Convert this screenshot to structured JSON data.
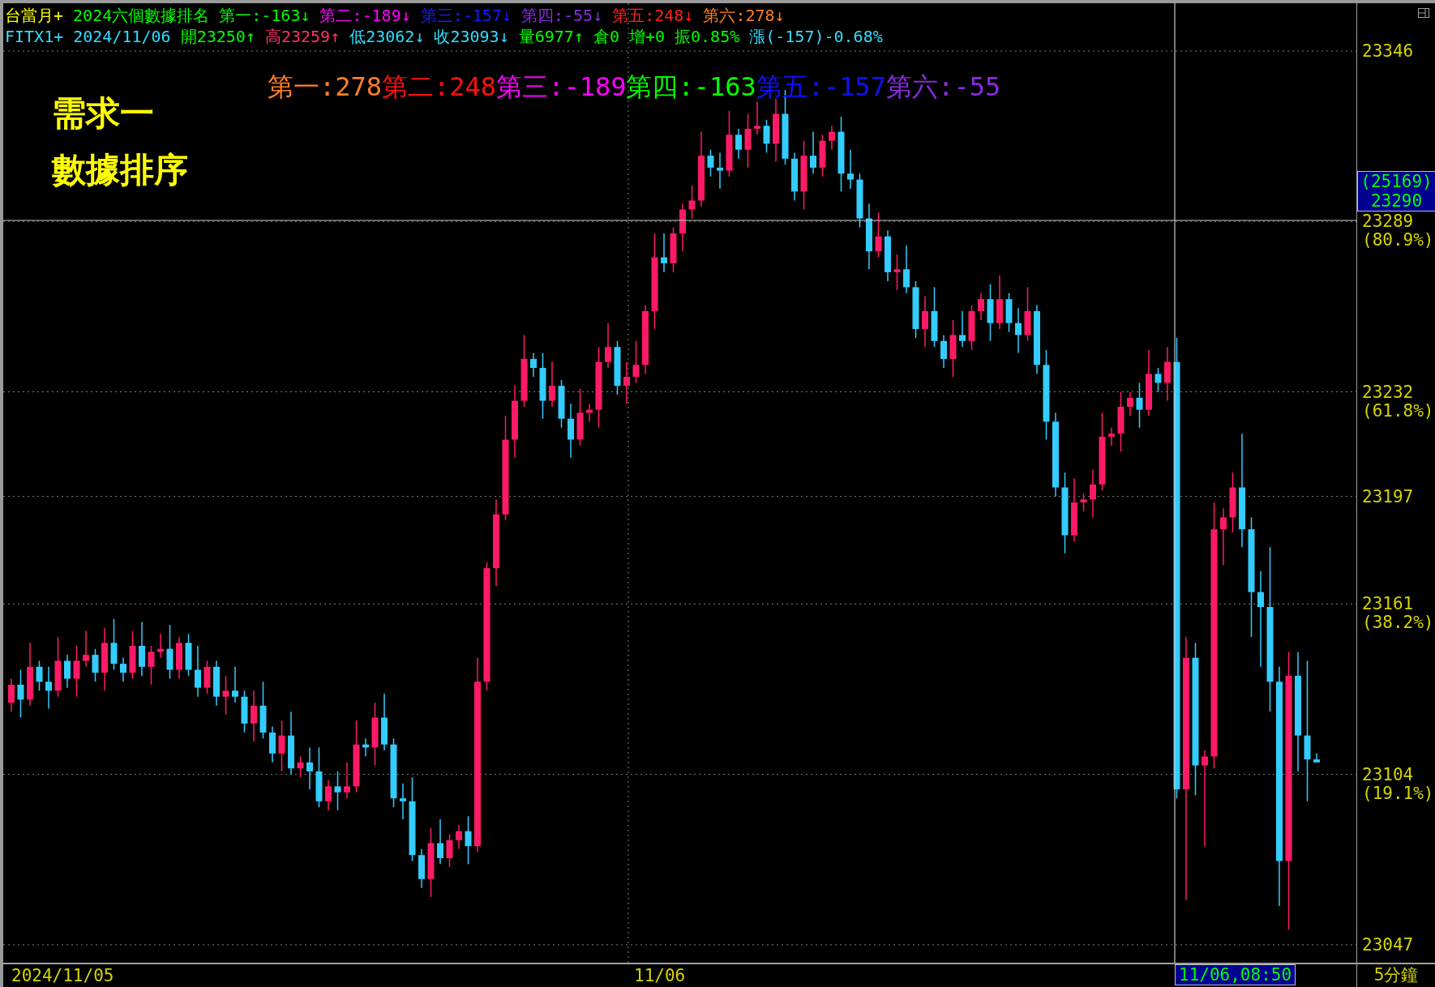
{
  "title_bar": {
    "symbol": "台當月+",
    "title": "2024六個數據排名",
    "rankings": [
      {
        "text": "第一:-163↓",
        "color": "#00ff00"
      },
      {
        "text": "第二:-189↓",
        "color": "#ff00ff"
      },
      {
        "text": "第三:-157↓",
        "color": "#1a1aff"
      },
      {
        "text": "第四:-55↓",
        "color": "#8a2be2"
      },
      {
        "text": "第五:248↓",
        "color": "#ff2020"
      },
      {
        "text": "第六:278↓",
        "color": "#ff8020"
      }
    ]
  },
  "quote_bar": {
    "symbol": "FITX1+",
    "date": "2024/11/06",
    "fields": [
      {
        "text": "開23250↑",
        "color": "#00ff00"
      },
      {
        "text": "高23259↑",
        "color": "#ff3366"
      },
      {
        "text": "低23062↓",
        "color": "#33ddff"
      },
      {
        "text": "收23093↓",
        "color": "#33ddff"
      },
      {
        "text": "量6977↑",
        "color": "#00ff00"
      },
      {
        "text": "倉0",
        "color": "#00ff00"
      },
      {
        "text": "增+0",
        "color": "#00ff00"
      },
      {
        "text": "振0.85%",
        "color": "#00ff00"
      },
      {
        "text": "漲(-157)-0.68%",
        "color": "#33ddff"
      }
    ]
  },
  "ranking_overlay": [
    {
      "text": "第一:278",
      "color": "#ff7f27"
    },
    {
      "text": "第二:248",
      "color": "#ff1010"
    },
    {
      "text": "第三:-189",
      "color": "#ff00ff"
    },
    {
      "text": "第四:-163",
      "color": "#00ff00"
    },
    {
      "text": "第五:-157",
      "color": "#1010ff"
    },
    {
      "text": "第六:-55",
      "color": "#8a2be2"
    }
  ],
  "notes": [
    "需求一",
    "數據排序"
  ],
  "chart_data": {
    "type": "candlestick",
    "grid": true,
    "ylim": [
      23041,
      23362
    ],
    "yticks": [
      23047,
      23104,
      23161,
      23197,
      23232,
      23289,
      23346
    ],
    "ohlc": [
      [
        23128,
        23136,
        23125,
        23134
      ],
      [
        23134,
        23139,
        23123,
        23129
      ],
      [
        23129,
        23148,
        23127,
        23140
      ],
      [
        23140,
        23142,
        23132,
        23135
      ],
      [
        23135,
        23140,
        23126,
        23132
      ],
      [
        23132,
        23150,
        23130,
        23142
      ],
      [
        23142,
        23144,
        23133,
        23136
      ],
      [
        23136,
        23147,
        23130,
        23142
      ],
      [
        23142,
        23152,
        23140,
        23144
      ],
      [
        23144,
        23146,
        23135,
        23138
      ],
      [
        23138,
        23153,
        23132,
        23148
      ],
      [
        23148,
        23156,
        23139,
        23141
      ],
      [
        23141,
        23143,
        23135,
        23138
      ],
      [
        23138,
        23152,
        23136,
        23147
      ],
      [
        23147,
        23155,
        23137,
        23140
      ],
      [
        23140,
        23147,
        23134,
        23145
      ],
      [
        23145,
        23151,
        23143,
        23146
      ],
      [
        23146,
        23154,
        23136,
        23139
      ],
      [
        23139,
        23150,
        23136,
        23148
      ],
      [
        23148,
        23151,
        23137,
        23139
      ],
      [
        23139,
        23147,
        23130,
        23133
      ],
      [
        23133,
        23142,
        23131,
        23140
      ],
      [
        23140,
        23142,
        23127,
        23130
      ],
      [
        23130,
        23137,
        23124,
        23132
      ],
      [
        23132,
        23140,
        23128,
        23130
      ],
      [
        23130,
        23132,
        23118,
        23121
      ],
      [
        23121,
        23132,
        23115,
        23127
      ],
      [
        23127,
        23135,
        23116,
        23118
      ],
      [
        23118,
        23120,
        23108,
        23111
      ],
      [
        23111,
        23122,
        23105,
        23117
      ],
      [
        23117,
        23125,
        23104,
        23106
      ],
      [
        23106,
        23110,
        23103,
        23108
      ],
      [
        23108,
        23113,
        23099,
        23105
      ],
      [
        23105,
        23113,
        23093,
        23095
      ],
      [
        23095,
        23102,
        23092,
        23100
      ],
      [
        23100,
        23105,
        23092,
        23098
      ],
      [
        23098,
        23108,
        23096,
        23100
      ],
      [
        23100,
        23122,
        23098,
        23114
      ],
      [
        23114,
        23116,
        23110,
        23113
      ],
      [
        23113,
        23128,
        23107,
        23123
      ],
      [
        23123,
        23131,
        23112,
        23114
      ],
      [
        23114,
        23116,
        23093,
        23096
      ],
      [
        23096,
        23101,
        23089,
        23095
      ],
      [
        23095,
        23103,
        23075,
        23077
      ],
      [
        23077,
        23079,
        23066,
        23069
      ],
      [
        23069,
        23086,
        23063,
        23081
      ],
      [
        23081,
        23089,
        23074,
        23076
      ],
      [
        23076,
        23084,
        23073,
        23082
      ],
      [
        23082,
        23087,
        23079,
        23085
      ],
      [
        23085,
        23090,
        23074,
        23080
      ],
      [
        23080,
        23143,
        23078,
        23135
      ],
      [
        23135,
        23175,
        23132,
        23173
      ],
      [
        23173,
        23196,
        23167,
        23191
      ],
      [
        23191,
        23224,
        23189,
        23216
      ],
      [
        23216,
        23234,
        23210,
        23229
      ],
      [
        23229,
        23251,
        23227,
        23243
      ],
      [
        23243,
        23245,
        23237,
        23240
      ],
      [
        23240,
        23245,
        23223,
        23229
      ],
      [
        23229,
        23242,
        23227,
        23234
      ],
      [
        23234,
        23236,
        23220,
        23223
      ],
      [
        23223,
        23228,
        23210,
        23216
      ],
      [
        23216,
        23233,
        23214,
        23225
      ],
      [
        23225,
        23228,
        23222,
        23226
      ],
      [
        23226,
        23247,
        23220,
        23242
      ],
      [
        23242,
        23255,
        23240,
        23247
      ],
      [
        23247,
        23249,
        23231,
        23234
      ],
      [
        23234,
        23242,
        23228,
        23237
      ],
      [
        23237,
        23249,
        23235,
        23241
      ],
      [
        23241,
        23261,
        23238,
        23259
      ],
      [
        23259,
        23285,
        23253,
        23277
      ],
      [
        23277,
        23285,
        23272,
        23275
      ],
      [
        23275,
        23287,
        23272,
        23285
      ],
      [
        23285,
        23295,
        23279,
        23293
      ],
      [
        23293,
        23301,
        23290,
        23296
      ],
      [
        23296,
        23319,
        23294,
        23311
      ],
      [
        23311,
        23313,
        23304,
        23307
      ],
      [
        23307,
        23312,
        23300,
        23306
      ],
      [
        23306,
        23326,
        23304,
        23318
      ],
      [
        23318,
        23320,
        23310,
        23313
      ],
      [
        23313,
        23325,
        23307,
        23320
      ],
      [
        23320,
        23329,
        23318,
        23321
      ],
      [
        23321,
        23323,
        23312,
        23315
      ],
      [
        23315,
        23330,
        23309,
        23325
      ],
      [
        23325,
        23333,
        23308,
        23310
      ],
      [
        23310,
        23312,
        23296,
        23299
      ],
      [
        23299,
        23316,
        23293,
        23311
      ],
      [
        23311,
        23319,
        23305,
        23307
      ],
      [
        23307,
        23318,
        23304,
        23316
      ],
      [
        23316,
        23321,
        23313,
        23319
      ],
      [
        23319,
        23324,
        23299,
        23305
      ],
      [
        23305,
        23313,
        23300,
        23303
      ],
      [
        23303,
        23305,
        23287,
        23290
      ],
      [
        23290,
        23295,
        23273,
        23279
      ],
      [
        23279,
        23292,
        23277,
        23284
      ],
      [
        23284,
        23286,
        23269,
        23272
      ],
      [
        23272,
        23278,
        23266,
        23273
      ],
      [
        23273,
        23281,
        23265,
        23267
      ],
      [
        23267,
        23269,
        23250,
        23253
      ],
      [
        23253,
        23264,
        23247,
        23259
      ],
      [
        23259,
        23267,
        23247,
        23249
      ],
      [
        23249,
        23251,
        23240,
        23243
      ],
      [
        23243,
        23256,
        23237,
        23251
      ],
      [
        23251,
        23259,
        23247,
        23249
      ],
      [
        23249,
        23261,
        23246,
        23259
      ],
      [
        23259,
        23265,
        23256,
        23263
      ],
      [
        23263,
        23268,
        23249,
        23255
      ],
      [
        23255,
        23271,
        23253,
        23263
      ],
      [
        23263,
        23265,
        23252,
        23255
      ],
      [
        23255,
        23260,
        23245,
        23251
      ],
      [
        23251,
        23267,
        23249,
        23259
      ],
      [
        23259,
        23261,
        23238,
        23241
      ],
      [
        23241,
        23246,
        23216,
        23222
      ],
      [
        23222,
        23225,
        23197,
        23200
      ],
      [
        23200,
        23205,
        23178,
        23184
      ],
      [
        23184,
        23203,
        23182,
        23195
      ],
      [
        23195,
        23198,
        23192,
        23196
      ],
      [
        23196,
        23206,
        23190,
        23201
      ],
      [
        23201,
        23225,
        23199,
        23217
      ],
      [
        23217,
        23220,
        23214,
        23218
      ],
      [
        23218,
        23232,
        23212,
        23227
      ],
      [
        23227,
        23232,
        23224,
        23230
      ],
      [
        23230,
        23235,
        23220,
        23226
      ],
      [
        23226,
        23246,
        23224,
        23238
      ],
      [
        23238,
        23240,
        23232,
        23235
      ],
      [
        23235,
        23247,
        23229,
        23242
      ],
      [
        23242,
        23250,
        23096,
        23099
      ],
      [
        23099,
        23150,
        23062,
        23143
      ],
      [
        23143,
        23148,
        23097,
        23107
      ],
      [
        23107,
        23112,
        23080,
        23110
      ],
      [
        23110,
        23195,
        23106,
        23186
      ],
      [
        23186,
        23193,
        23174,
        23190
      ],
      [
        23190,
        23205,
        23185,
        23200
      ],
      [
        23200,
        23218,
        23180,
        23186
      ],
      [
        23186,
        23190,
        23150,
        23165
      ],
      [
        23165,
        23172,
        23140,
        23160
      ],
      [
        23160,
        23180,
        23125,
        23135
      ],
      [
        23135,
        23140,
        23060,
        23075
      ],
      [
        23075,
        23145,
        23052,
        23137
      ],
      [
        23137,
        23145,
        23105,
        23117
      ],
      [
        23117,
        23142,
        23095,
        23109
      ],
      [
        23109,
        23111,
        23108,
        23108
      ]
    ]
  },
  "price_axis": {
    "retracements": [
      "(80.9%)",
      "(61.8%)",
      "(38.2%)",
      "(19.1%)"
    ],
    "cursor_tag": {
      "count": "(25169)",
      "price": "23290"
    }
  },
  "time_axis": {
    "labels": [
      "2024/11/05",
      "11/06"
    ],
    "cursor_time": "11/06,08:50",
    "period": "5分鐘"
  }
}
